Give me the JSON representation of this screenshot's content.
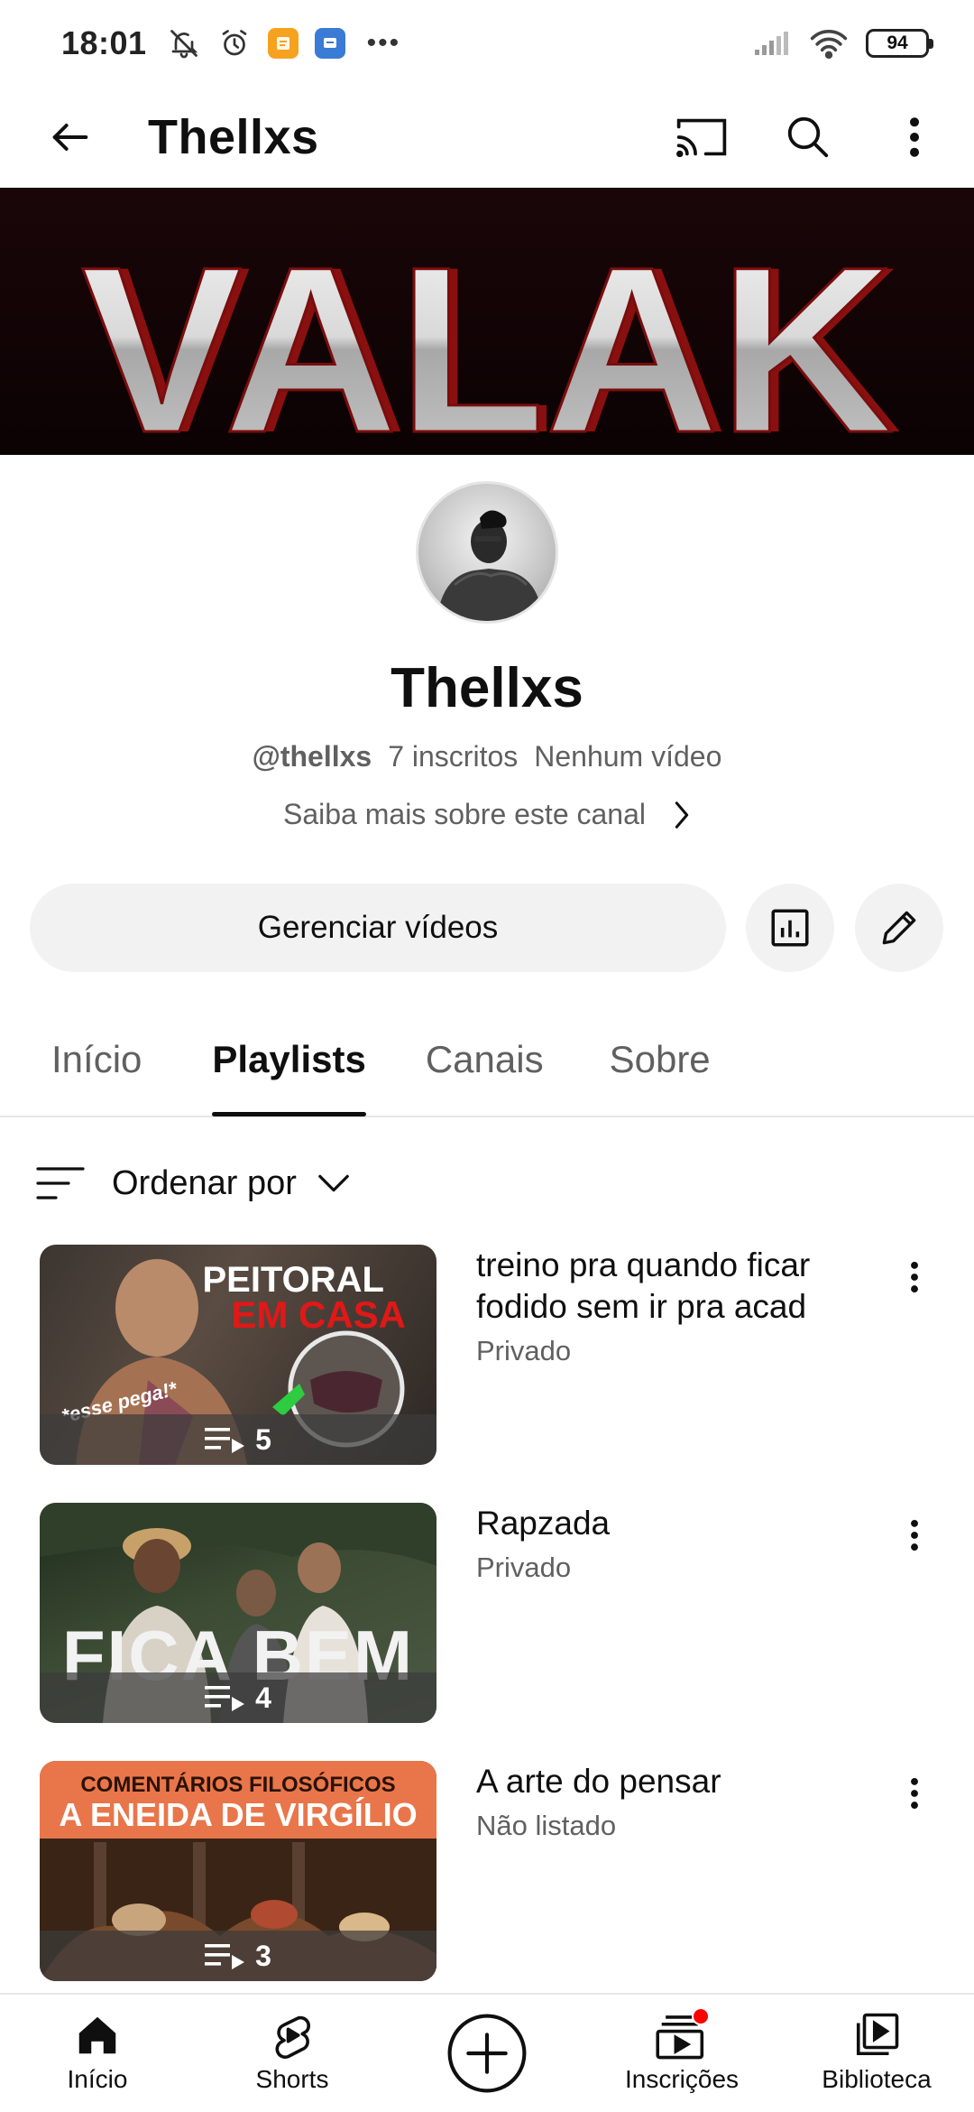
{
  "status_bar": {
    "time": "18:01",
    "battery": "94",
    "more": "•••"
  },
  "app_bar": {
    "title": "Thellxs"
  },
  "banner": {
    "text": "VALAK"
  },
  "channel": {
    "name": "Thellxs",
    "handle": "@thellxs",
    "subscribers": "7 inscritos",
    "videos": "Nenhum vídeo",
    "about_link": "Saiba mais sobre este canal"
  },
  "actions": {
    "manage_label": "Gerenciar vídeos"
  },
  "tabs": [
    {
      "label": "Início",
      "active": false
    },
    {
      "label": "Playlists",
      "active": true
    },
    {
      "label": "Canais",
      "active": false
    },
    {
      "label": "Sobre",
      "active": false
    }
  ],
  "sort": {
    "label": "Ordenar por"
  },
  "playlists": [
    {
      "title": "treino pra quando ficar fodido sem ir pra acad",
      "status": "Privado",
      "count": "5",
      "thumb_text_1": "PEITORAL",
      "thumb_text_2": "EM CASA",
      "thumb_text_3": "*esse pega!*"
    },
    {
      "title": "Rapzada",
      "status": "Privado",
      "count": "4",
      "thumb_text_1": "FICA BEM"
    },
    {
      "title": "A arte do pensar",
      "status": "Não listado",
      "count": "3",
      "thumb_text_1": "COMENTÁRIOS FILOSÓFICOS",
      "thumb_text_2": "A ENEIDA DE VIRGÍLIO"
    }
  ],
  "bottom_nav": {
    "home": "Início",
    "shorts": "Shorts",
    "subscriptions": "Inscrições",
    "library": "Biblioteca"
  },
  "colors": {
    "accent_red": "#ff0000",
    "text_primary": "#0f0f0f",
    "text_secondary": "#606060",
    "chip_bg": "#f2f2f2"
  }
}
